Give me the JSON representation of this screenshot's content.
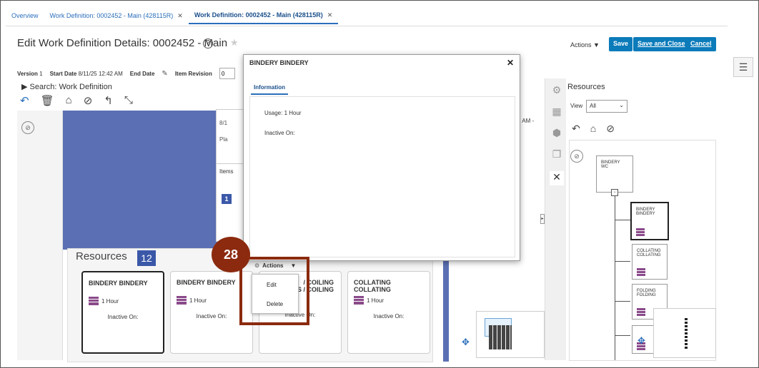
{
  "tabs": [
    {
      "label": "Overview",
      "closable": false,
      "active": false
    },
    {
      "label": "Work Definition: 0002452 - Main (428115R)",
      "closable": true,
      "active": false
    },
    {
      "label": "Work Definition: 0002452 - Main (428115R)",
      "closable": true,
      "active": true
    }
  ],
  "page": {
    "title": "Edit Work Definition Details: 0002452 - Main",
    "actions_label": "Actions",
    "save_label": "Save",
    "save_close_label": "Save and Close",
    "cancel_label": "Cancel"
  },
  "infobar": {
    "version_label": "Version",
    "version_value": "1",
    "start_label": "Start Date",
    "start_value": "8/11/25 12:42 AM",
    "end_label": "End Date",
    "revision_label": "Item Revision",
    "revision_value": "0"
  },
  "search": {
    "label": "Search: Work Definition"
  },
  "canvas": {
    "op_date_fragment": "8/1",
    "op_pla_fragment": "Pla",
    "items_label": "Items",
    "items_badge": "1",
    "date_fragment": "2 AM -"
  },
  "resources": {
    "title": "Resources",
    "count": "12",
    "cards": [
      {
        "name": "BINDERY BINDERY",
        "hours": "1 Hour",
        "inactive": "Inactive On:",
        "selected": true
      },
      {
        "name": "BINDERY BINDERY",
        "hours": "1 Hour",
        "inactive": "Inactive On:",
        "selected": false
      },
      {
        "name": "/ COILING\nS / COILING",
        "hours": "",
        "inactive": "Inactive On:",
        "selected": false
      },
      {
        "name": "COLLATING\nCOLLATING",
        "hours": "1 Hour",
        "inactive": "Inactive On:",
        "selected": false
      }
    ]
  },
  "dialog": {
    "title": "BINDERY BINDERY",
    "tab": "Information",
    "usage": "Usage: 1 Hour",
    "inactive": "Inactive On:"
  },
  "card_menu": {
    "actions_label": "Actions",
    "items": [
      "Edit",
      "Delete"
    ]
  },
  "step": {
    "number": "28"
  },
  "side_panel": {
    "title": "Resources",
    "view_label": "View",
    "view_value": "All",
    "nodes": [
      {
        "label": "BINDERY WC"
      },
      {
        "label": "BINDERY\nBINDERY"
      },
      {
        "label": "COLLATING\nCOLLATING"
      },
      {
        "label": "FOLDING\nFOLDING"
      }
    ]
  },
  "colors": {
    "accent": "#0b7bba",
    "canvas": "#5b70b4",
    "highlight": "#8b2a0e",
    "resource_icon": "#8a4a8a"
  }
}
